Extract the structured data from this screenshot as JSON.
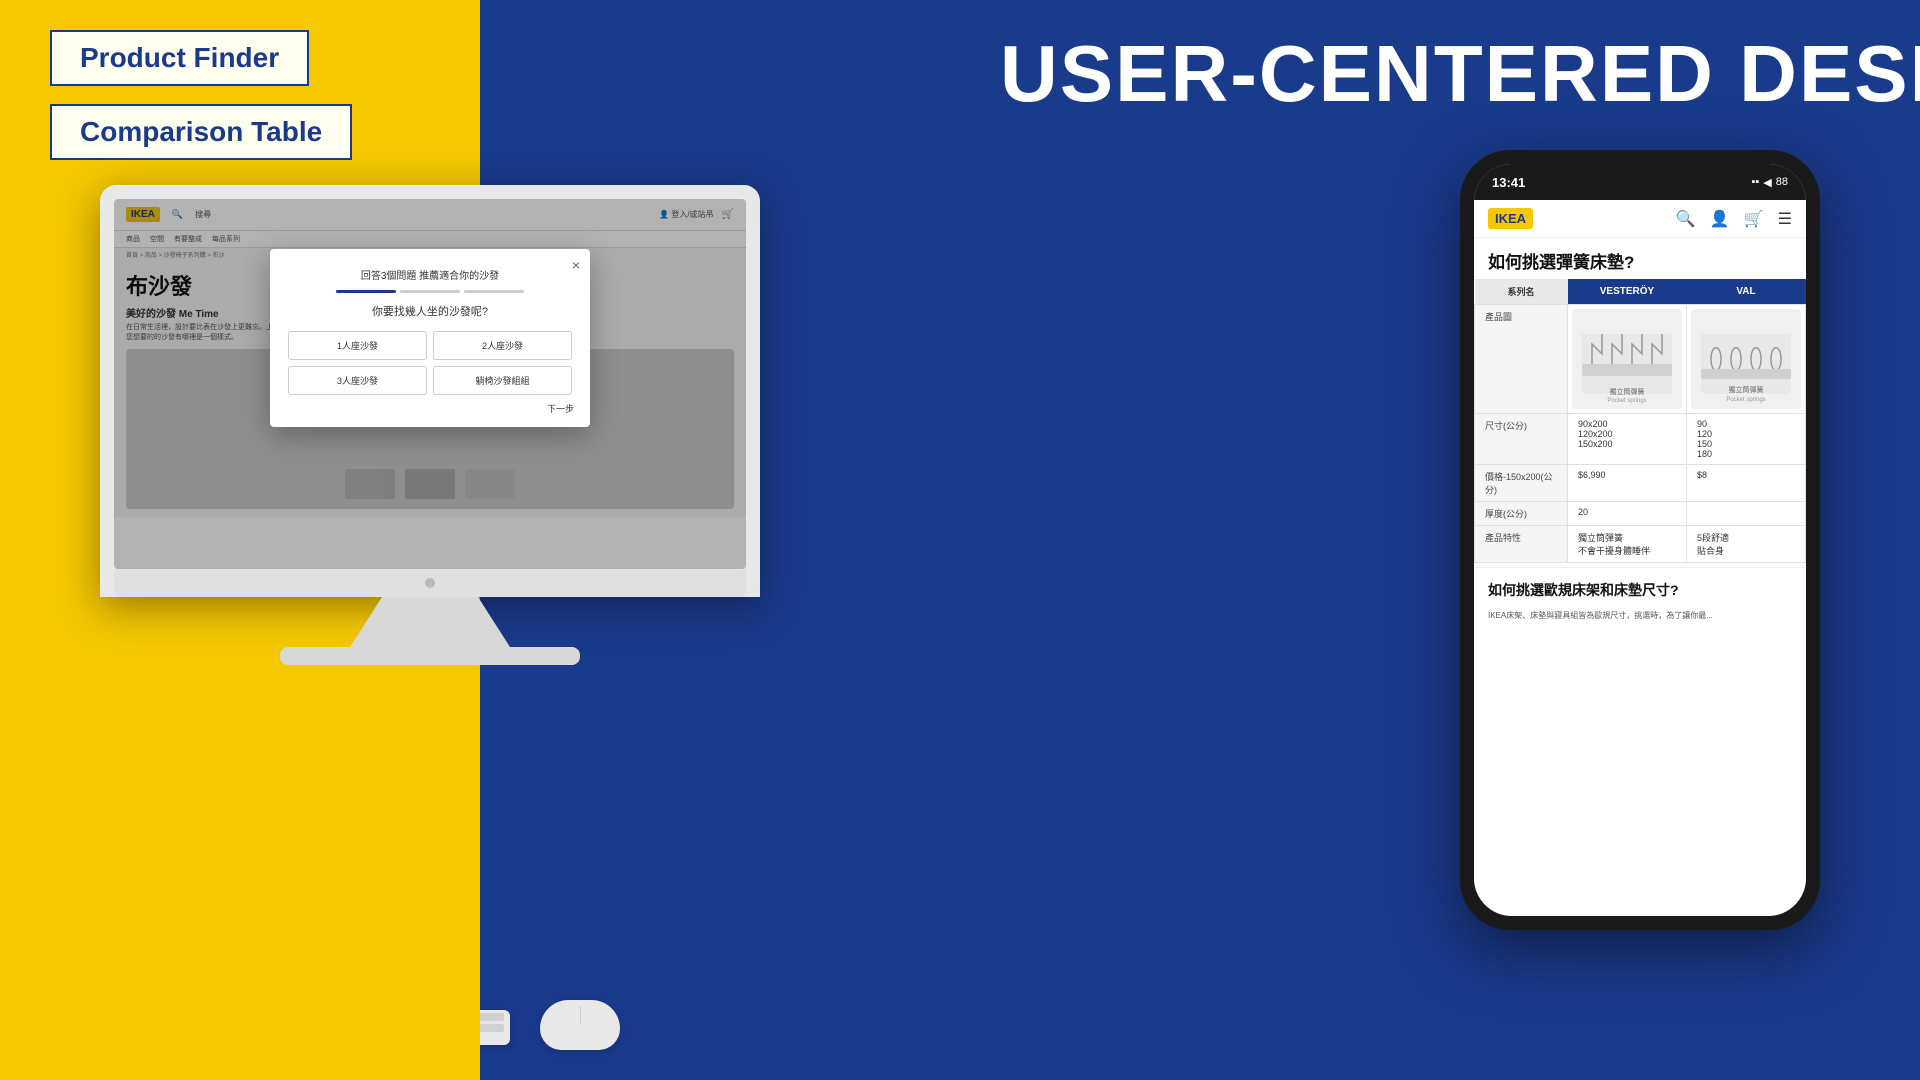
{
  "layout": {
    "background_left": "#F5C800",
    "background_right": "#1a3a8c"
  },
  "header": {
    "main_title": "USER-CENTERED DESIGN"
  },
  "tags": [
    {
      "id": "product-finder",
      "label": "Product Finder"
    },
    {
      "id": "comparison-table",
      "label": "Comparison Table"
    }
  ],
  "desktop": {
    "ikea_logo": "IKEA",
    "nav_items": [
      "商品",
      "空間",
      "有要整成",
      "每品系列"
    ],
    "search_placeholder": "搜尋",
    "breadcrumb": "首頁 > 商品 > 沙發椅子系列購 > 布沙",
    "page_heading": "布沙發",
    "page_subtitle": "美好的沙發 Me Time",
    "page_desc": "在日常生活裡，設計要比表在沙發上更難忘。上這裡，或者看看您想要的的沙發有哪裡是一個樣式。",
    "modal": {
      "title": "回答3個問題 推薦適合你的沙發",
      "question": "你要找幾人坐的沙發呢?",
      "options": [
        "1人座沙發",
        "2人座沙發",
        "3人座沙發",
        "躺椅沙發組組"
      ],
      "next_label": "下一步",
      "close_symbol": "×"
    }
  },
  "phone": {
    "time": "13:41",
    "status_icons": "▪▪ ◀ 88",
    "ikea_logo": "IKEA",
    "page_title": "如何挑選彈簧床墊?",
    "table": {
      "col_header_label": "系列名",
      "col1": "VESTERÖY",
      "col2": "VAL",
      "rows": [
        {
          "label": "產品圖",
          "col1_content": "spring_image_1",
          "col2_content": "spring_image_2"
        },
        {
          "label": "尺寸(公分)",
          "col1_content": "90x200\n120x200\n150x200",
          "col2_content": "90\n120\n150\n180"
        },
        {
          "label": "價格-150x200(公分)",
          "col1_content": "$6,990",
          "col2_content": "$8"
        },
        {
          "label": "厚度(公分)",
          "col1_content": "20",
          "col2_content": ""
        },
        {
          "label": "產品特性",
          "col1_content": "獨立筒彈簧\n不會干擾身體睡伴",
          "col2_content": "5段舒適\n貼合身"
        }
      ]
    },
    "bottom_title": "如何挑選歐規床架和床墊尺寸?",
    "bottom_desc": "IKEA床架、床墊與寢具組皆為歐規尺寸，挑選時，為了讓你最..."
  }
}
